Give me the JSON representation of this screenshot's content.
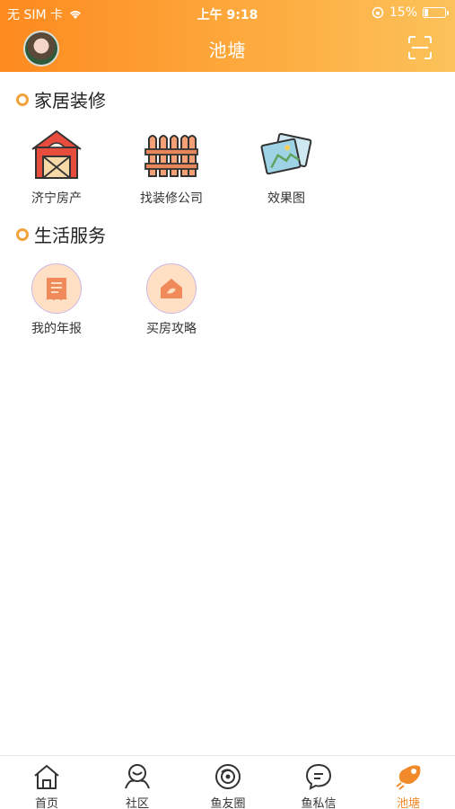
{
  "status_bar": {
    "carrier": "无 SIM 卡",
    "time": "上午 9:18",
    "battery": "15%",
    "battery_level": 0.15
  },
  "header": {
    "title": "池塘"
  },
  "sections": [
    {
      "title": "家居装修",
      "items": [
        {
          "label": "济宁房产",
          "icon": "barn-icon"
        },
        {
          "label": "找装修公司",
          "icon": "fence-icon"
        },
        {
          "label": "效果图",
          "icon": "gallery-icon"
        }
      ]
    },
    {
      "title": "生活服务",
      "items": [
        {
          "label": "我的年报",
          "icon": "report-icon"
        },
        {
          "label": "买房攻略",
          "icon": "house-guide-icon"
        }
      ]
    }
  ],
  "tabbar": {
    "items": [
      {
        "label": "首页",
        "icon": "home-icon"
      },
      {
        "label": "社区",
        "icon": "community-icon"
      },
      {
        "label": "鱼友圈",
        "icon": "circle-icon"
      },
      {
        "label": "鱼私信",
        "icon": "message-icon"
      },
      {
        "label": "池塘",
        "icon": "pond-icon",
        "active": true
      }
    ]
  },
  "colors": {
    "accent": "#f08a2a",
    "header_start": "#fd8a1f",
    "header_end": "#fcc25a"
  }
}
